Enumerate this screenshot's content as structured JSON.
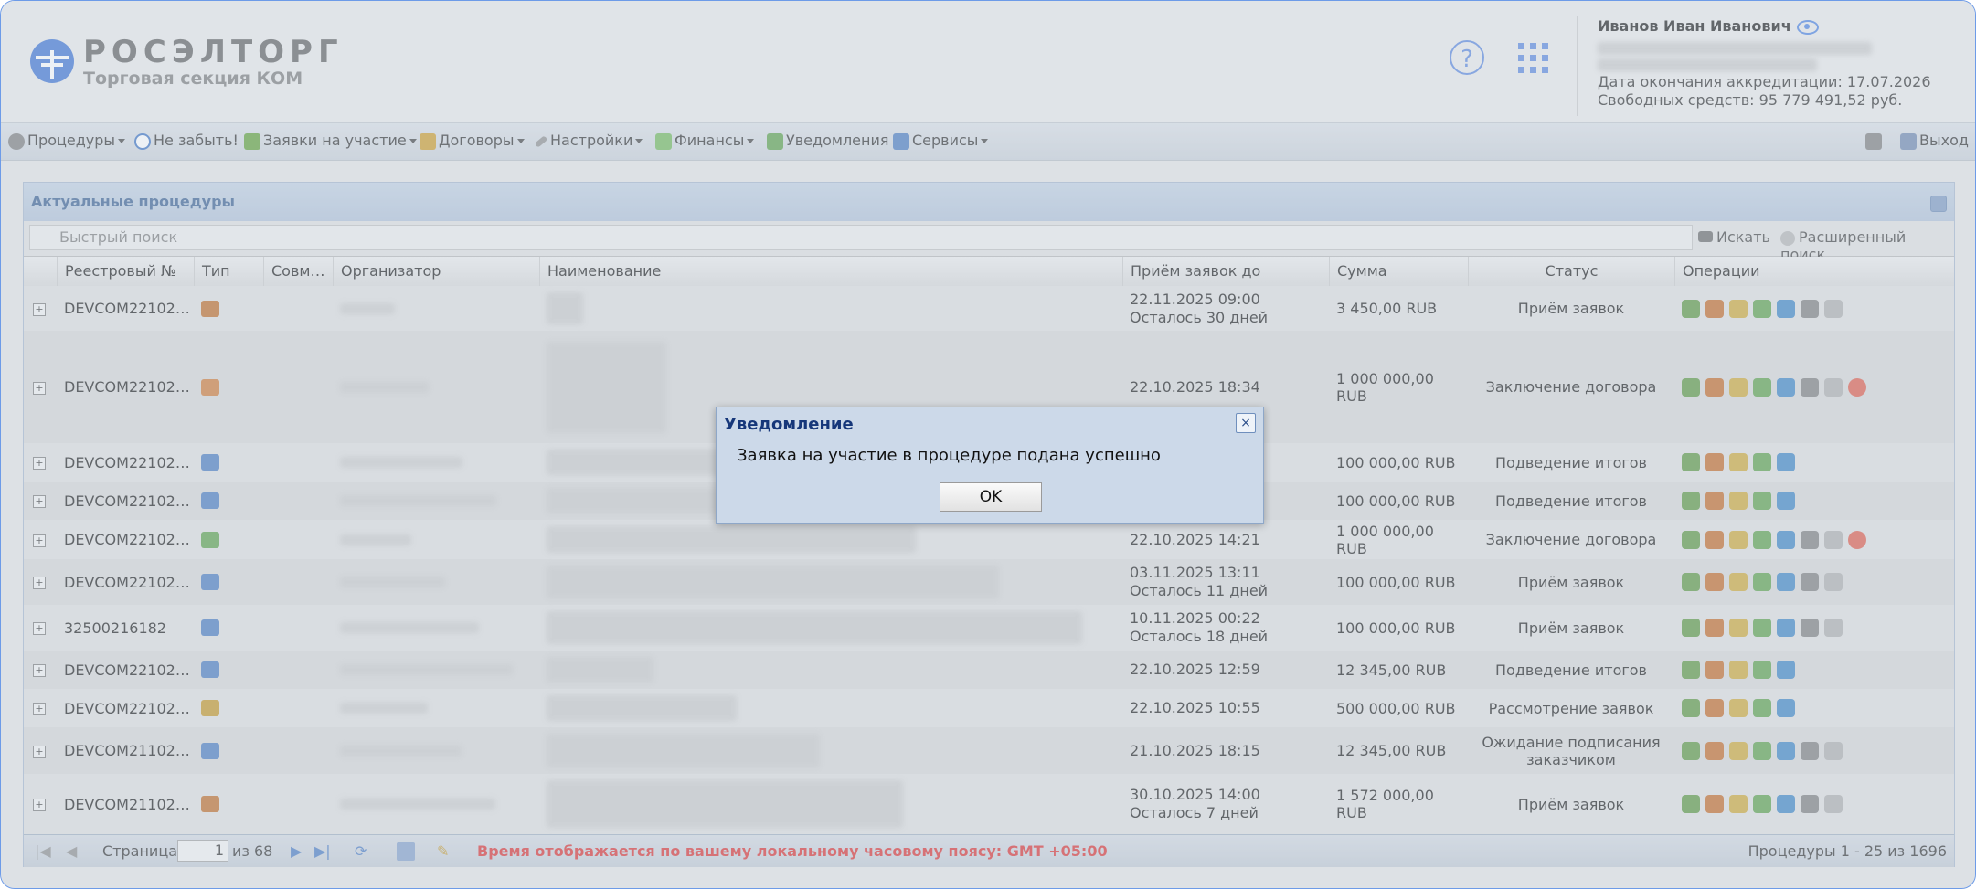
{
  "header": {
    "brand": "РОСЭЛТОРГ",
    "brand_sub": "Торговая секция КОМ",
    "user_name": "Иванов Иван Иванович",
    "accreditation": "Дата окончания аккредитации: 17.07.2026",
    "funds": "Свободных средств: 95 779 491,52 руб."
  },
  "menu": {
    "procedures": "Процедуры",
    "dont_forget": "Не забыть!",
    "applications": "Заявки на участие",
    "contracts": "Договоры",
    "settings": "Настройки",
    "finance": "Финансы",
    "notifications": "Уведомления",
    "services": "Сервисы",
    "logout": "Выход"
  },
  "panel": {
    "title": "Актуальные процедуры",
    "search_placeholder": "Быстрый поиск",
    "search_btn": "Искать",
    "advanced_btn": "Расширенный поиск"
  },
  "columns": {
    "reg": "Реестровый №",
    "type": "Тип",
    "joint": "Совм…",
    "org": "Организатор",
    "name": "Наименование",
    "deadline": "Приём заявок до",
    "sum": "Сумма",
    "status": "Статус",
    "ops": "Операции"
  },
  "rows": [
    {
      "reg": "DEVCOM22102…",
      "deadline": "22.11.2025 09:00",
      "remaining": "Осталось 30 дней",
      "sum": "3 450,00 RUB",
      "status": "Приём заявок"
    },
    {
      "reg": "DEVCOM22102…",
      "deadline": "22.10.2025 18:34",
      "remaining": "",
      "sum": "1 000 000,00 RUB",
      "status": "Заключение договора"
    },
    {
      "reg": "DEVCOM22102…",
      "deadline": "",
      "remaining": "",
      "sum": "100 000,00 RUB",
      "status": "Подведение итогов"
    },
    {
      "reg": "DEVCOM22102…",
      "deadline": "",
      "remaining": "",
      "sum": "100 000,00 RUB",
      "status": "Подведение итогов"
    },
    {
      "reg": "DEVCOM22102…",
      "deadline": "22.10.2025 14:21",
      "remaining": "",
      "sum": "1 000 000,00 RUB",
      "status": "Заключение договора"
    },
    {
      "reg": "DEVCOM22102…",
      "deadline": "03.11.2025 13:11",
      "remaining": "Осталось 11 дней",
      "sum": "100 000,00 RUB",
      "status": "Приём заявок"
    },
    {
      "reg": "32500216182",
      "deadline": "10.11.2025 00:22",
      "remaining": "Осталось 18 дней",
      "sum": "100 000,00 RUB",
      "status": "Приём заявок"
    },
    {
      "reg": "DEVCOM22102…",
      "deadline": "22.10.2025 12:59",
      "remaining": "",
      "sum": "12 345,00 RUB",
      "status": "Подведение итогов"
    },
    {
      "reg": "DEVCOM22102…",
      "deadline": "22.10.2025 10:55",
      "remaining": "",
      "sum": "500 000,00 RUB",
      "status": "Рассмотрение заявок"
    },
    {
      "reg": "DEVCOM21102…",
      "deadline": "21.10.2025 18:15",
      "remaining": "",
      "sum": "12 345,00 RUB",
      "status": "Ожидание подписания заказчиком"
    },
    {
      "reg": "DEVCOM21102…",
      "deadline": "30.10.2025 14:00",
      "remaining": "Осталось 7 дней",
      "sum": "1 572 000,00 RUB",
      "status": "Приём заявок"
    }
  ],
  "pager": {
    "page_label": "Страница",
    "page_value": "1",
    "of_label": "из 68",
    "tz_note": "Время отображается по вашему локальному часовому поясу: GMT +05:00",
    "summary": "Процедуры 1 - 25 из 1696"
  },
  "dialog": {
    "title": "Уведомление",
    "message": "Заявка на участие в процедуре подана успешно",
    "ok": "OK",
    "close": "×"
  }
}
